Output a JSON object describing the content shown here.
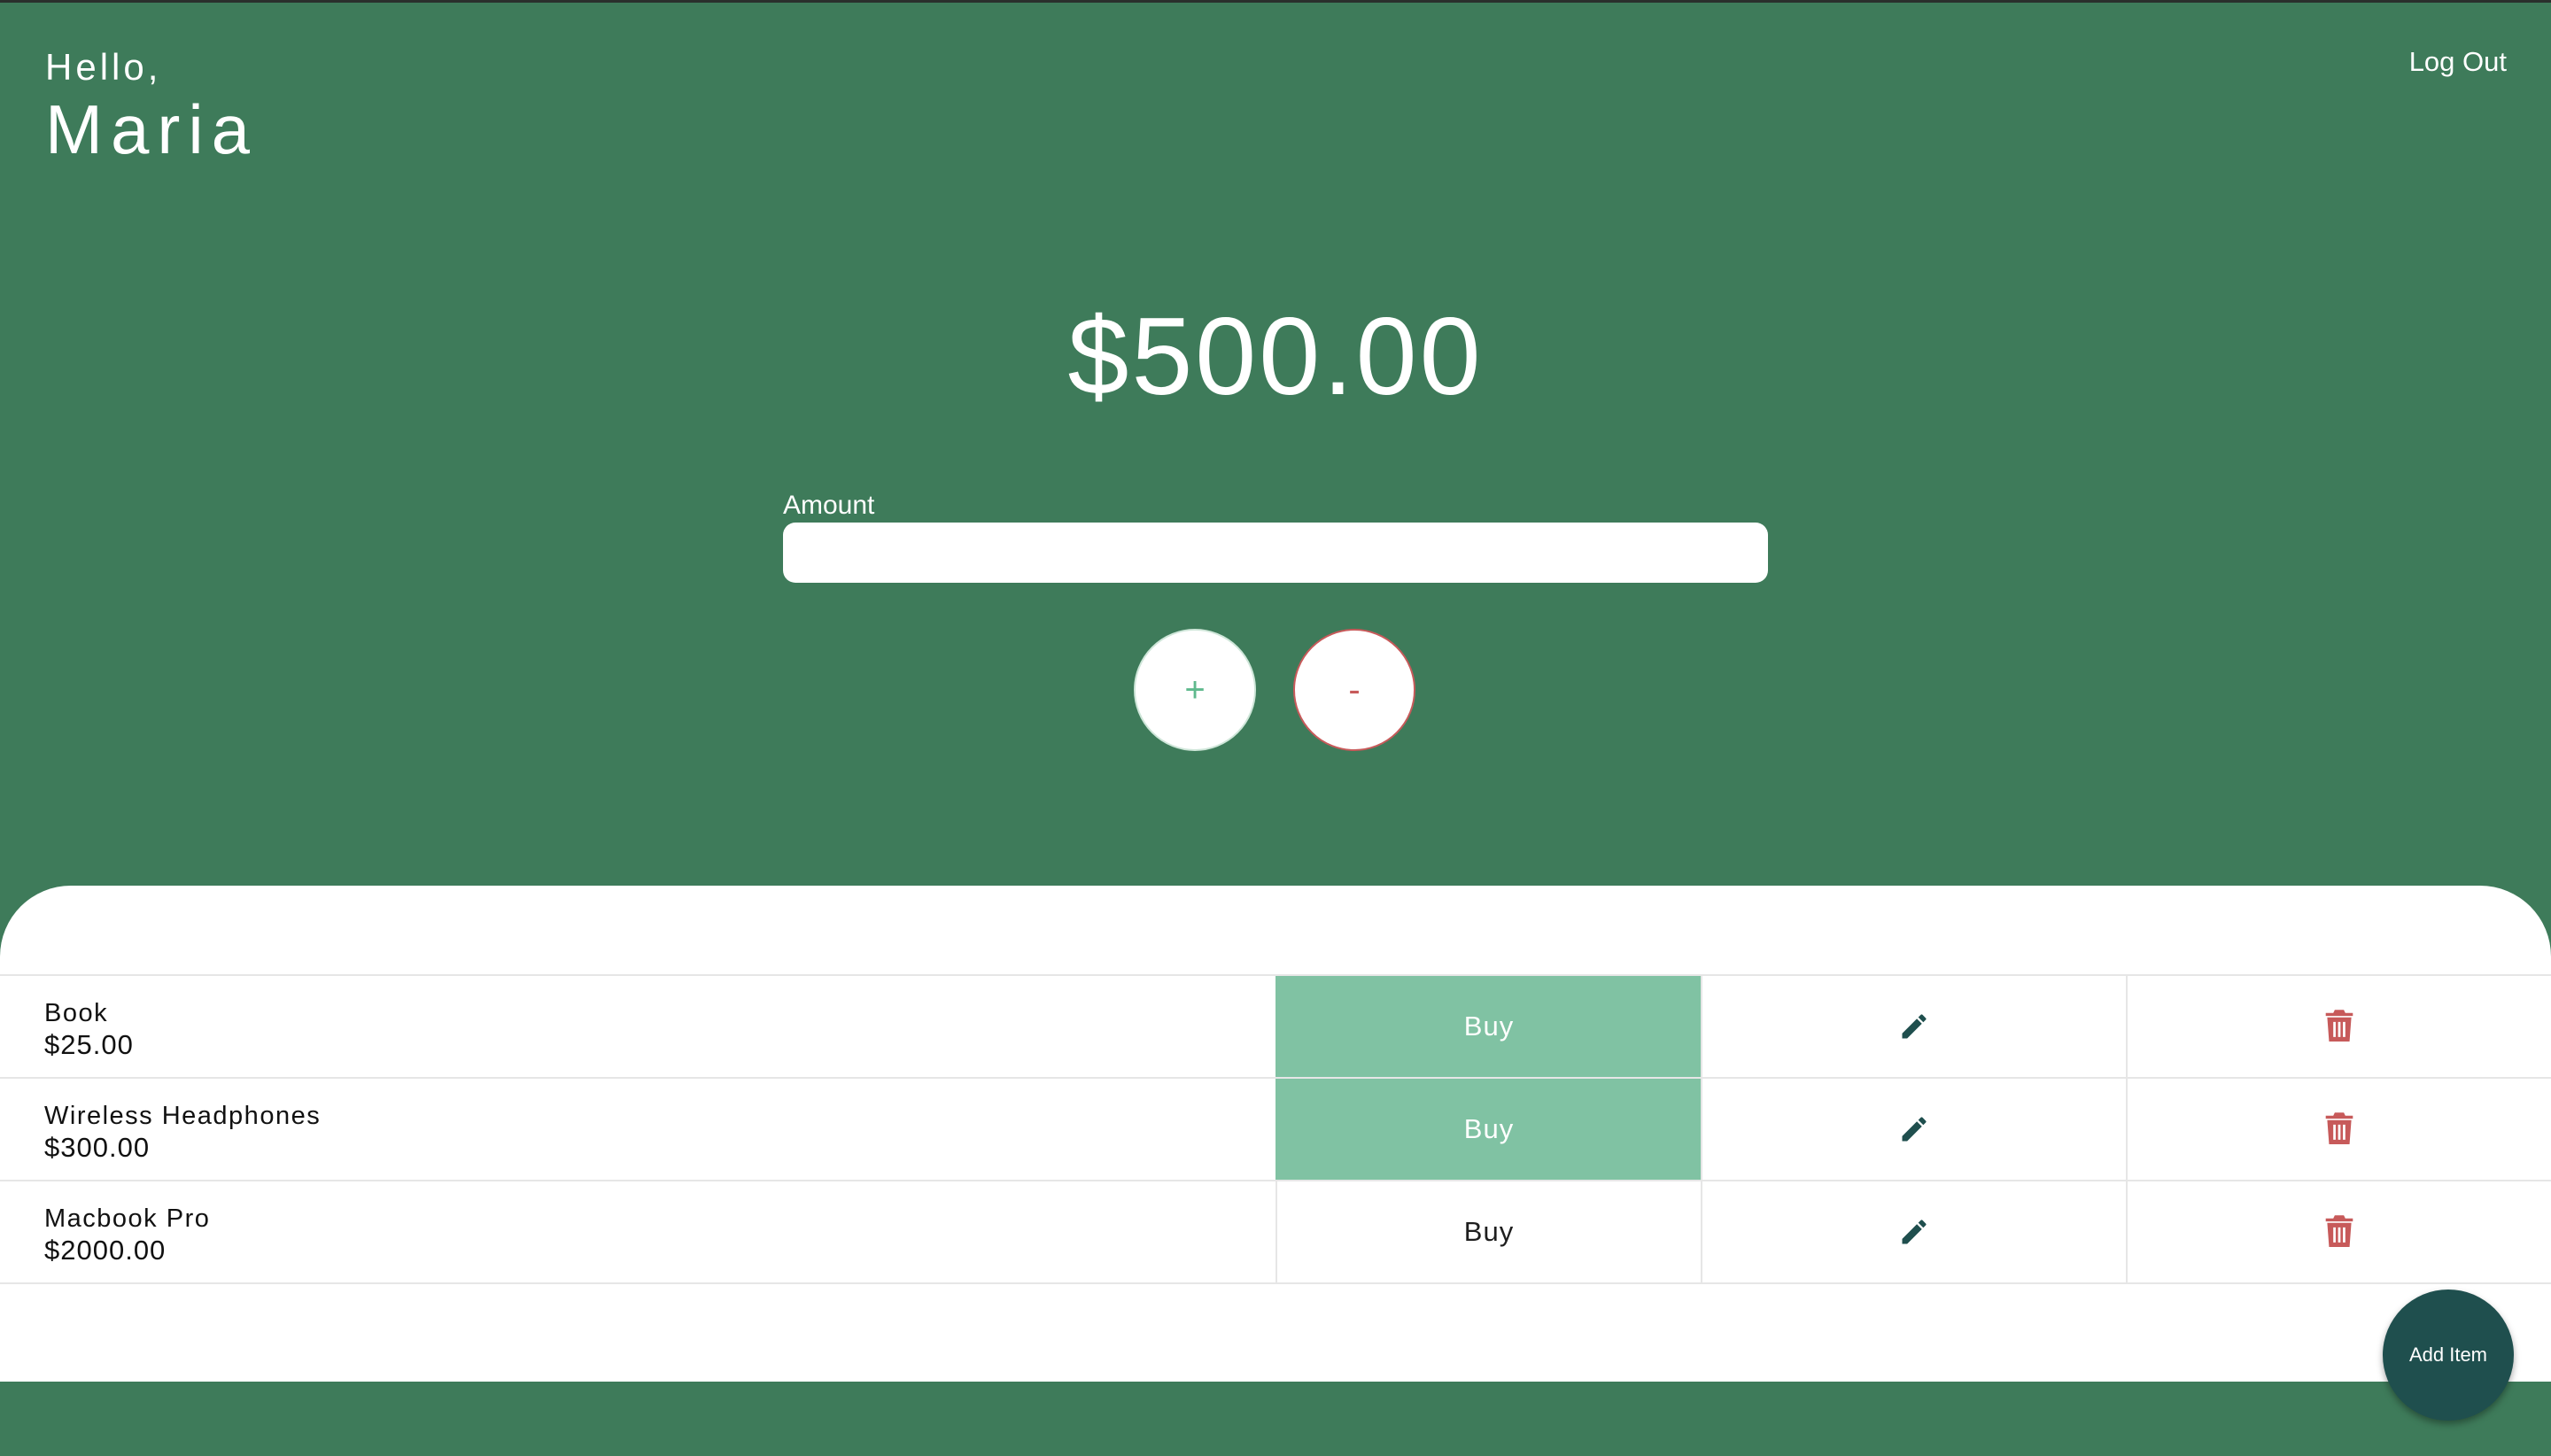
{
  "header": {
    "greeting": "Hello,",
    "username": "Maria",
    "logout_label": "Log Out"
  },
  "wallet": {
    "balance": "$500.00",
    "amount_label": "Amount",
    "amount_value": "",
    "plus_label": "+",
    "minus_label": "-"
  },
  "items": [
    {
      "name": "Book",
      "price": "$25.00",
      "buy_label": "Buy",
      "affordable": true
    },
    {
      "name": "Wireless Headphones",
      "price": "$300.00",
      "buy_label": "Buy",
      "affordable": true
    },
    {
      "name": "Macbook Pro",
      "price": "$2000.00",
      "buy_label": "Buy",
      "affordable": false
    }
  ],
  "actions": {
    "add_item_label": "Add Item"
  },
  "colors": {
    "background": "#3e7b5a",
    "buy_active": "#80c2a3",
    "edit_icon": "#1f4f4e",
    "delete_icon": "#c75a5a",
    "add_button": "#1f4f4e"
  },
  "icons": {
    "edit": "pencil-icon",
    "delete": "trash-icon"
  }
}
